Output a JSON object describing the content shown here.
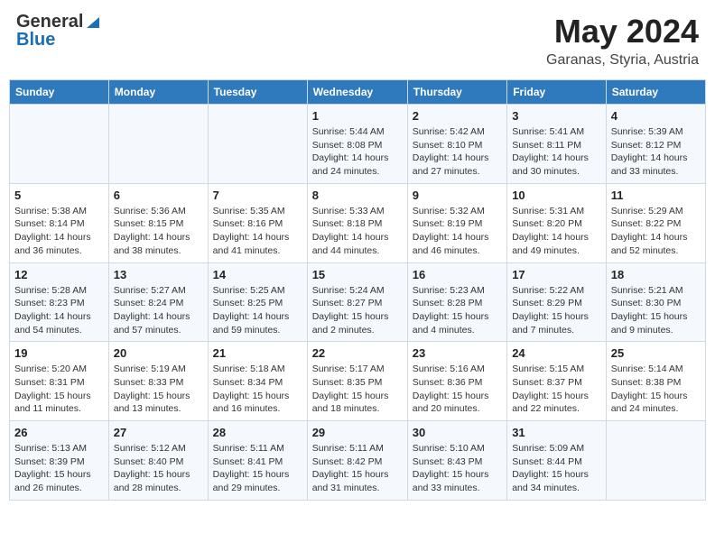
{
  "header": {
    "logo_general": "General",
    "logo_blue": "Blue",
    "month": "May 2024",
    "location": "Garanas, Styria, Austria"
  },
  "days_of_week": [
    "Sunday",
    "Monday",
    "Tuesday",
    "Wednesday",
    "Thursday",
    "Friday",
    "Saturday"
  ],
  "weeks": [
    [
      {
        "day": "",
        "sunrise": "",
        "sunset": "",
        "daylight": ""
      },
      {
        "day": "",
        "sunrise": "",
        "sunset": "",
        "daylight": ""
      },
      {
        "day": "",
        "sunrise": "",
        "sunset": "",
        "daylight": ""
      },
      {
        "day": "1",
        "sunrise": "Sunrise: 5:44 AM",
        "sunset": "Sunset: 8:08 PM",
        "daylight": "Daylight: 14 hours and 24 minutes."
      },
      {
        "day": "2",
        "sunrise": "Sunrise: 5:42 AM",
        "sunset": "Sunset: 8:10 PM",
        "daylight": "Daylight: 14 hours and 27 minutes."
      },
      {
        "day": "3",
        "sunrise": "Sunrise: 5:41 AM",
        "sunset": "Sunset: 8:11 PM",
        "daylight": "Daylight: 14 hours and 30 minutes."
      },
      {
        "day": "4",
        "sunrise": "Sunrise: 5:39 AM",
        "sunset": "Sunset: 8:12 PM",
        "daylight": "Daylight: 14 hours and 33 minutes."
      }
    ],
    [
      {
        "day": "5",
        "sunrise": "Sunrise: 5:38 AM",
        "sunset": "Sunset: 8:14 PM",
        "daylight": "Daylight: 14 hours and 36 minutes."
      },
      {
        "day": "6",
        "sunrise": "Sunrise: 5:36 AM",
        "sunset": "Sunset: 8:15 PM",
        "daylight": "Daylight: 14 hours and 38 minutes."
      },
      {
        "day": "7",
        "sunrise": "Sunrise: 5:35 AM",
        "sunset": "Sunset: 8:16 PM",
        "daylight": "Daylight: 14 hours and 41 minutes."
      },
      {
        "day": "8",
        "sunrise": "Sunrise: 5:33 AM",
        "sunset": "Sunset: 8:18 PM",
        "daylight": "Daylight: 14 hours and 44 minutes."
      },
      {
        "day": "9",
        "sunrise": "Sunrise: 5:32 AM",
        "sunset": "Sunset: 8:19 PM",
        "daylight": "Daylight: 14 hours and 46 minutes."
      },
      {
        "day": "10",
        "sunrise": "Sunrise: 5:31 AM",
        "sunset": "Sunset: 8:20 PM",
        "daylight": "Daylight: 14 hours and 49 minutes."
      },
      {
        "day": "11",
        "sunrise": "Sunrise: 5:29 AM",
        "sunset": "Sunset: 8:22 PM",
        "daylight": "Daylight: 14 hours and 52 minutes."
      }
    ],
    [
      {
        "day": "12",
        "sunrise": "Sunrise: 5:28 AM",
        "sunset": "Sunset: 8:23 PM",
        "daylight": "Daylight: 14 hours and 54 minutes."
      },
      {
        "day": "13",
        "sunrise": "Sunrise: 5:27 AM",
        "sunset": "Sunset: 8:24 PM",
        "daylight": "Daylight: 14 hours and 57 minutes."
      },
      {
        "day": "14",
        "sunrise": "Sunrise: 5:25 AM",
        "sunset": "Sunset: 8:25 PM",
        "daylight": "Daylight: 14 hours and 59 minutes."
      },
      {
        "day": "15",
        "sunrise": "Sunrise: 5:24 AM",
        "sunset": "Sunset: 8:27 PM",
        "daylight": "Daylight: 15 hours and 2 minutes."
      },
      {
        "day": "16",
        "sunrise": "Sunrise: 5:23 AM",
        "sunset": "Sunset: 8:28 PM",
        "daylight": "Daylight: 15 hours and 4 minutes."
      },
      {
        "day": "17",
        "sunrise": "Sunrise: 5:22 AM",
        "sunset": "Sunset: 8:29 PM",
        "daylight": "Daylight: 15 hours and 7 minutes."
      },
      {
        "day": "18",
        "sunrise": "Sunrise: 5:21 AM",
        "sunset": "Sunset: 8:30 PM",
        "daylight": "Daylight: 15 hours and 9 minutes."
      }
    ],
    [
      {
        "day": "19",
        "sunrise": "Sunrise: 5:20 AM",
        "sunset": "Sunset: 8:31 PM",
        "daylight": "Daylight: 15 hours and 11 minutes."
      },
      {
        "day": "20",
        "sunrise": "Sunrise: 5:19 AM",
        "sunset": "Sunset: 8:33 PM",
        "daylight": "Daylight: 15 hours and 13 minutes."
      },
      {
        "day": "21",
        "sunrise": "Sunrise: 5:18 AM",
        "sunset": "Sunset: 8:34 PM",
        "daylight": "Daylight: 15 hours and 16 minutes."
      },
      {
        "day": "22",
        "sunrise": "Sunrise: 5:17 AM",
        "sunset": "Sunset: 8:35 PM",
        "daylight": "Daylight: 15 hours and 18 minutes."
      },
      {
        "day": "23",
        "sunrise": "Sunrise: 5:16 AM",
        "sunset": "Sunset: 8:36 PM",
        "daylight": "Daylight: 15 hours and 20 minutes."
      },
      {
        "day": "24",
        "sunrise": "Sunrise: 5:15 AM",
        "sunset": "Sunset: 8:37 PM",
        "daylight": "Daylight: 15 hours and 22 minutes."
      },
      {
        "day": "25",
        "sunrise": "Sunrise: 5:14 AM",
        "sunset": "Sunset: 8:38 PM",
        "daylight": "Daylight: 15 hours and 24 minutes."
      }
    ],
    [
      {
        "day": "26",
        "sunrise": "Sunrise: 5:13 AM",
        "sunset": "Sunset: 8:39 PM",
        "daylight": "Daylight: 15 hours and 26 minutes."
      },
      {
        "day": "27",
        "sunrise": "Sunrise: 5:12 AM",
        "sunset": "Sunset: 8:40 PM",
        "daylight": "Daylight: 15 hours and 28 minutes."
      },
      {
        "day": "28",
        "sunrise": "Sunrise: 5:11 AM",
        "sunset": "Sunset: 8:41 PM",
        "daylight": "Daylight: 15 hours and 29 minutes."
      },
      {
        "day": "29",
        "sunrise": "Sunrise: 5:11 AM",
        "sunset": "Sunset: 8:42 PM",
        "daylight": "Daylight: 15 hours and 31 minutes."
      },
      {
        "day": "30",
        "sunrise": "Sunrise: 5:10 AM",
        "sunset": "Sunset: 8:43 PM",
        "daylight": "Daylight: 15 hours and 33 minutes."
      },
      {
        "day": "31",
        "sunrise": "Sunrise: 5:09 AM",
        "sunset": "Sunset: 8:44 PM",
        "daylight": "Daylight: 15 hours and 34 minutes."
      },
      {
        "day": "",
        "sunrise": "",
        "sunset": "",
        "daylight": ""
      }
    ]
  ]
}
